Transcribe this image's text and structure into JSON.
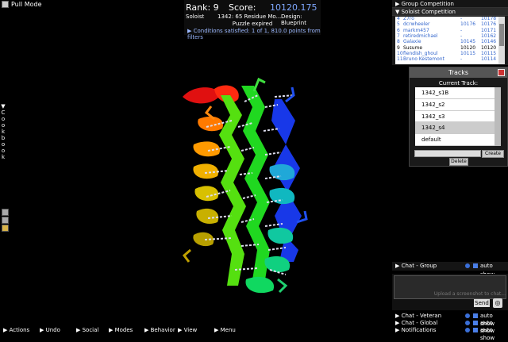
{
  "top_left": {
    "pull_mode": "Pull Mode"
  },
  "score_panel": {
    "rank": "Rank: 9",
    "score_label": "Score:",
    "score_value": "10120.175",
    "soloist": "Soloist",
    "residue": "1342: 65 Residue Mo...",
    "design": "Design: Blueprint",
    "status": "Puzzle expired",
    "conditions": "Conditions satisfied: 1 of 1, 810.0 points from filters"
  },
  "right_panel": {
    "group_competition": "Group Competition",
    "soloist_competition": "Soloist Competition"
  },
  "leaderboard": [
    {
      "rank": "4",
      "name": "Z7ro",
      "score": "-",
      "total": "10178"
    },
    {
      "rank": "5",
      "name": "dcrwheeler",
      "score": "10176",
      "total": "10176"
    },
    {
      "rank": "6",
      "name": "markm457",
      "score": "-",
      "total": "10171"
    },
    {
      "rank": "7",
      "name": "retiredmichael",
      "score": "-",
      "total": "10162"
    },
    {
      "rank": "8",
      "name": "Galaxie",
      "score": "10145",
      "total": "10146"
    },
    {
      "rank": "9",
      "name": "Susume",
      "score": "10120",
      "total": "10120"
    },
    {
      "rank": "10",
      "name": "fiendish_ghoul",
      "score": "10115",
      "total": "10115"
    },
    {
      "rank": "11",
      "name": "Bruno Kestemont",
      "score": "-",
      "total": "10114"
    }
  ],
  "tracks": {
    "title": "Tracks",
    "current_label": "Current Track:",
    "items": [
      "1342_s1B",
      "1342_s2",
      "1342_s3",
      "1342_s4",
      "default"
    ],
    "create_label": "Create",
    "delete_label": "Delete"
  },
  "chat": {
    "group": "Chat - Group",
    "placeholder": "Upload a screenshot to chat...",
    "send_label": "Send",
    "veteran": "Chat - Veteran",
    "global": "Chat - Global",
    "notifications": "Notifications",
    "auto_show": "auto show"
  },
  "sidebar": {
    "cookbook_letters": [
      "C",
      "o",
      "o",
      "k",
      "b",
      "o",
      "o",
      "k"
    ]
  },
  "bottom_bar": [
    "Actions",
    "Undo",
    "Social",
    "Modes",
    "Behavior",
    "View",
    "Menu"
  ],
  "icons": {
    "arrow": "triangle-right-icon",
    "info": "info-icon",
    "close": "close-icon"
  }
}
